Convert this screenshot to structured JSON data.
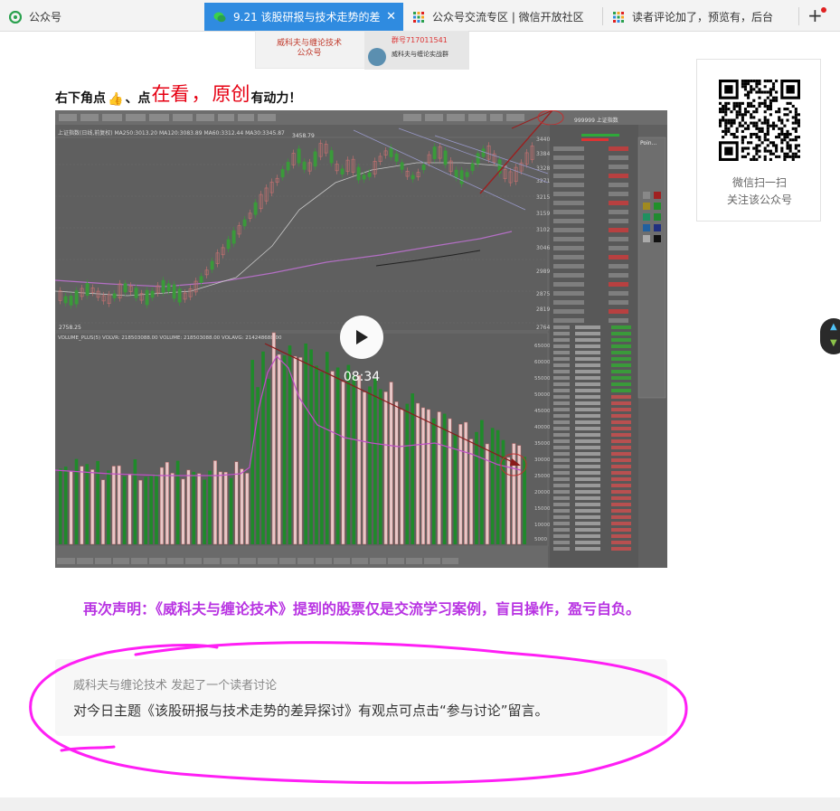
{
  "browser": {
    "tabs": [
      {
        "title": "公众号",
        "active": false
      },
      {
        "title": "9.21 该股研报与技术走势的差",
        "active": true
      },
      {
        "title": "公众号交流专区 | 微信开放社区",
        "active": false
      },
      {
        "title": "读者评论加了，预览有，后台",
        "active": false
      }
    ],
    "close_glyph": "✕",
    "new_tab_glyph": "+"
  },
  "article": {
    "banner": {
      "title": "威科夫与缠论技术",
      "subtitle": "公众号",
      "group_id": "群号717011541",
      "group_name": "威科夫与缠论实战群"
    },
    "cta": {
      "prefix": "右下角点",
      "thumb": "👍",
      "mid": "、点",
      "word1": "在看",
      "sep": "，",
      "word2": "原创",
      "suffix": "有动力！"
    },
    "video": {
      "duration": "08:34",
      "chart_header": "上证指数(日线,前复权) MA250:3013.20 MA120:3083.89 MA60:3312.44 MA30:3345.87",
      "chart_price_high": "3458.79",
      "chart_price_low": "2758.25",
      "volume_header": "VOLUME_PLUS(5) VOLVR: 218503088.00  VOLUME: 218503088.00  VOLAVG: 214248688.00",
      "index_code": "999999 上证指数",
      "tool_panel_title": "Poin..."
    },
    "statement": "再次声明：《威科夫与缠论技术》提到的股票仅是交流学习案例，盲目操作，盈亏自负。",
    "discussion": {
      "header": "威科夫与缠论技术 发起了一个读者讨论",
      "body": "对今日主题《该股研报与技术走势的差异探讨》有观点可点击“参与讨论”留言。"
    }
  },
  "qr_card": {
    "line1": "微信扫一扫",
    "line2": "关注该公众号"
  },
  "colors": {
    "active_tab": "#2f8be0",
    "accent_red": "#e60012",
    "statement_purple": "#b833e2",
    "annotation_magenta": "#ff1ff5"
  }
}
